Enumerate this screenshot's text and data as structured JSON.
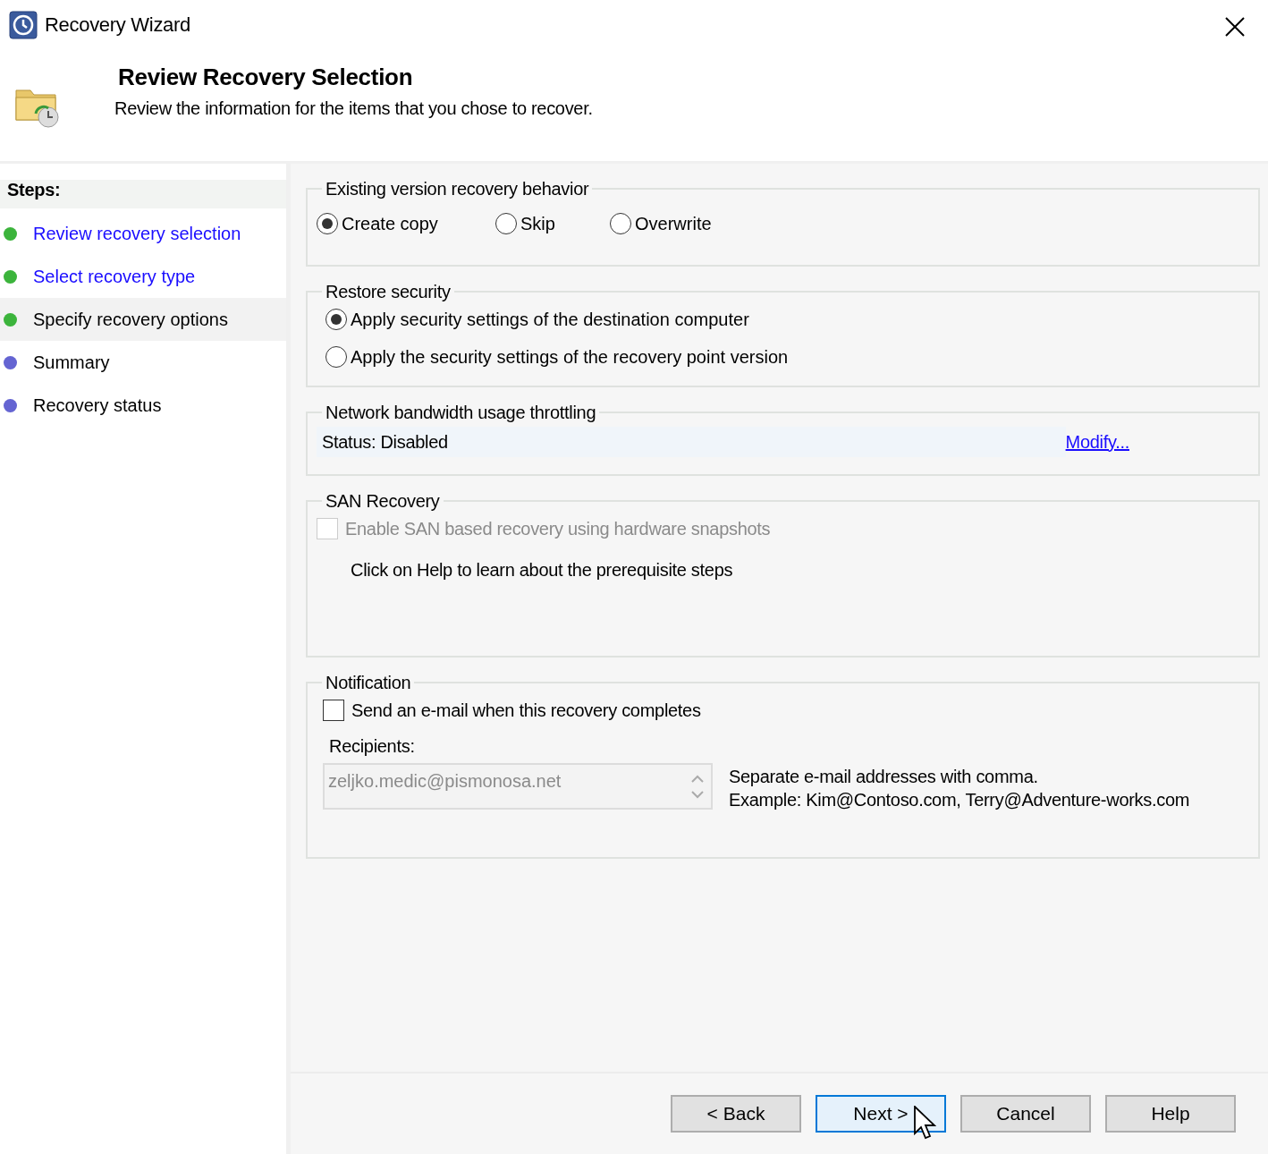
{
  "window": {
    "title": "Recovery Wizard"
  },
  "header": {
    "title": "Review Recovery Selection",
    "subtitle": "Review the information for the items that you chose to recover."
  },
  "steps": {
    "heading": "Steps:",
    "items": [
      {
        "label": "Review recovery selection",
        "color": "#3cb43c",
        "kind": "link",
        "selected": false
      },
      {
        "label": "Select recovery type",
        "color": "#3cb43c",
        "kind": "link",
        "selected": false
      },
      {
        "label": "Specify recovery options",
        "color": "#3cb43c",
        "kind": "text",
        "selected": true
      },
      {
        "label": "Summary",
        "color": "#6464d2",
        "kind": "text",
        "selected": false
      },
      {
        "label": "Recovery status",
        "color": "#6464d2",
        "kind": "text",
        "selected": false
      }
    ]
  },
  "existing_version": {
    "title": "Existing version recovery behavior",
    "options": [
      {
        "label": "Create copy",
        "selected": true
      },
      {
        "label": "Skip",
        "selected": false
      },
      {
        "label": "Overwrite",
        "selected": false
      }
    ]
  },
  "restore_security": {
    "title": "Restore security",
    "options": [
      {
        "label": "Apply security settings of the destination computer",
        "selected": true
      },
      {
        "label": "Apply the security settings of the recovery point version",
        "selected": false
      }
    ]
  },
  "bandwidth": {
    "title": "Network bandwidth usage throttling",
    "status": "Status: Disabled",
    "link": "Modify..."
  },
  "san": {
    "title": "SAN Recovery",
    "checkbox": {
      "label": "Enable SAN based recovery using hardware snapshots",
      "checked": false,
      "disabled": true
    },
    "note": "Click on Help to learn about the prerequisite steps"
  },
  "notification": {
    "title": "Notification",
    "checkbox": {
      "label": "Send an e-mail when this recovery completes",
      "checked": false,
      "disabled": false
    },
    "recipients_label": "Recipients:",
    "recipients": {
      "value": "zeljko.medic@pismonosa.net",
      "disabled": true
    },
    "hint": [
      "Separate e-mail addresses with comma.",
      "Example: Kim@Contoso.com, Terry@Adventure-works.com"
    ]
  },
  "buttons": [
    {
      "label": "< Back",
      "focused": false
    },
    {
      "label": "Next >",
      "focused": true
    },
    {
      "label": "Cancel",
      "focused": false
    },
    {
      "label": "Help",
      "focused": false
    }
  ]
}
